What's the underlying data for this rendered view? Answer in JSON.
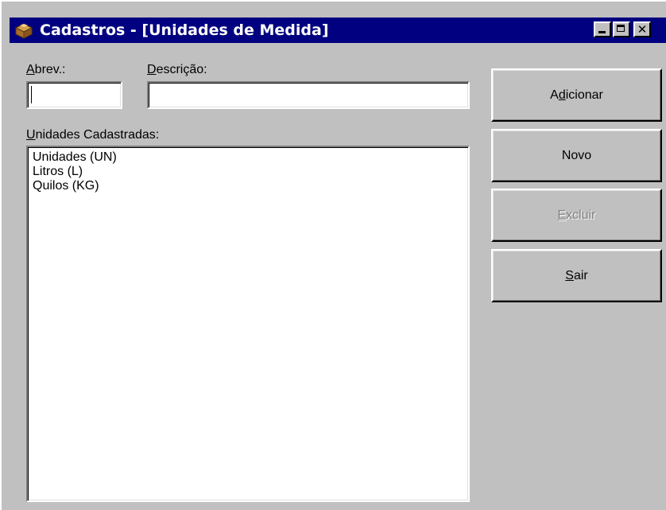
{
  "window": {
    "title": "Cadastros - [Unidades de Medida]",
    "title_bar_color": "#000080",
    "face_color": "#c0c0c0",
    "controls": {
      "minimize_icon": "minimize-icon",
      "maximize_icon": "maximize-icon",
      "close_icon": "close-icon",
      "close_glyph": "✕"
    }
  },
  "form": {
    "abrev": {
      "label_accel": "A",
      "label_rest": "brev.:",
      "value": ""
    },
    "descricao": {
      "label_accel": "D",
      "label_rest": "escrição:",
      "value": ""
    },
    "list": {
      "label_accel": "U",
      "label_rest": "nidades Cadastradas:",
      "items": [
        "Unidades (UN)",
        "Litros (L)",
        "Quilos (KG)"
      ]
    }
  },
  "buttons": {
    "adicionar": {
      "before": "A",
      "accel": "d",
      "after": "icionar",
      "enabled": true
    },
    "novo": {
      "before": "",
      "accel": "",
      "after": "Novo",
      "enabled": true
    },
    "excluir": {
      "before": "",
      "accel": "E",
      "after": "xcluir",
      "enabled": false
    },
    "sair": {
      "before": "",
      "accel": "S",
      "after": "air",
      "enabled": true
    }
  }
}
